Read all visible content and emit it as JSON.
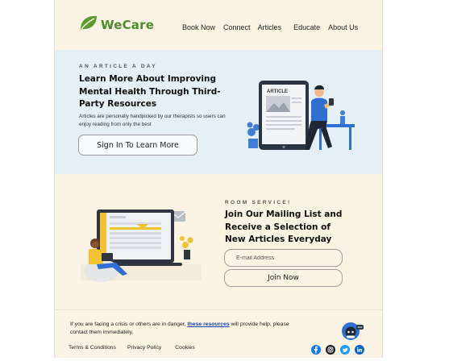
{
  "brand": {
    "name": "WeCare",
    "color": "#4f8a30"
  },
  "nav": {
    "book_now": "Book Now",
    "connect": "Connect",
    "articles": "Articles",
    "educate": "Educate",
    "about_us": "About Us"
  },
  "hero": {
    "eyebrow": "AN ARTICLE A DAY",
    "title": "Learn More About Improving Mental Health Through Third-Party Resources",
    "subtitle": "Articles are personally handpicked by our therapists so users can enjoy reading from only the best",
    "cta": "Sign In To Learn More",
    "illustration_label": "ARTICLE",
    "bg_color": "#e4f0f6"
  },
  "mailing": {
    "eyebrow": "ROOM SERVICE!",
    "title": "Join Our Mailing List and Receive a Selection of New Articles Everyday",
    "email_placeholder": "E-mail Address",
    "join_label": "Join Now"
  },
  "footer": {
    "crisis_before": "If you are facing a crisis or others are in danger, ",
    "crisis_link": "these resources",
    "crisis_after": " will provide help, please contact them immediately.",
    "links": {
      "terms": "Terms & Conditions",
      "privacy": "Privacy Policy",
      "cookies": "Cookies"
    },
    "socials": [
      "facebook-icon",
      "instagram-icon",
      "twitter-icon",
      "linkedin-icon"
    ]
  },
  "colors": {
    "page_bg": "#fbf4e4",
    "accent_blue": "#2f6fd1",
    "link_blue": "#1a43b8"
  }
}
